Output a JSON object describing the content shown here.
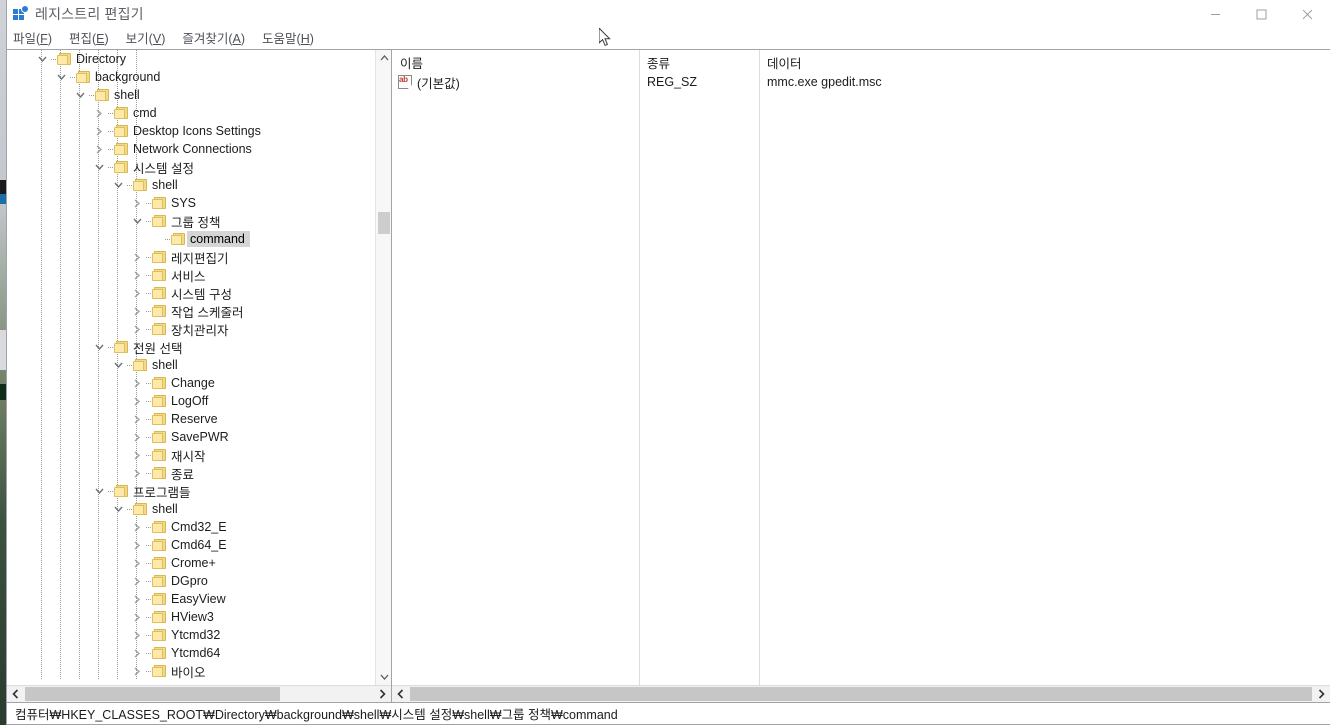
{
  "window": {
    "title": "레지스트리 편집기",
    "app_icon": "registry-grid-icon",
    "controls": {
      "minimize": "minimize-icon",
      "maximize": "maximize-icon",
      "close": "close-icon"
    }
  },
  "menu": [
    {
      "text": "파일",
      "pre": "파일(",
      "accel": "F",
      "post": ")"
    },
    {
      "text": "편집",
      "pre": "편집(",
      "accel": "E",
      "post": ")"
    },
    {
      "text": "보기",
      "pre": "보기(",
      "accel": "V",
      "post": ")"
    },
    {
      "text": "즐겨찾기",
      "pre": "즐겨찾기(",
      "accel": "A",
      "post": ")"
    },
    {
      "text": "도움말",
      "pre": "도움말(",
      "accel": "H",
      "post": ")"
    }
  ],
  "tree": {
    "rows": [
      {
        "label": "Directory",
        "depth": 1,
        "state": "expanded"
      },
      {
        "label": "background",
        "depth": 2,
        "state": "expanded"
      },
      {
        "label": "shell",
        "depth": 3,
        "state": "expanded"
      },
      {
        "label": "cmd",
        "depth": 4,
        "state": "collapsed"
      },
      {
        "label": "Desktop Icons Settings",
        "depth": 4,
        "state": "collapsed"
      },
      {
        "label": "Network Connections",
        "depth": 4,
        "state": "collapsed"
      },
      {
        "label": "시스템 설정",
        "depth": 4,
        "state": "expanded"
      },
      {
        "label": "shell",
        "depth": 5,
        "state": "expanded"
      },
      {
        "label": "SYS",
        "depth": 6,
        "state": "collapsed"
      },
      {
        "label": "그룹 정책",
        "depth": 6,
        "state": "expanded"
      },
      {
        "label": "command",
        "depth": 7,
        "state": "leaf",
        "selected": true
      },
      {
        "label": "레지편집기",
        "depth": 6,
        "state": "collapsed"
      },
      {
        "label": "서비스",
        "depth": 6,
        "state": "collapsed"
      },
      {
        "label": "시스템 구성",
        "depth": 6,
        "state": "collapsed"
      },
      {
        "label": "작업 스케줄러",
        "depth": 6,
        "state": "collapsed"
      },
      {
        "label": "장치관리자",
        "depth": 6,
        "state": "collapsed"
      },
      {
        "label": "전원 선택",
        "depth": 4,
        "state": "expanded"
      },
      {
        "label": "shell",
        "depth": 5,
        "state": "expanded"
      },
      {
        "label": "Change",
        "depth": 6,
        "state": "collapsed"
      },
      {
        "label": "LogOff",
        "depth": 6,
        "state": "collapsed"
      },
      {
        "label": "Reserve",
        "depth": 6,
        "state": "collapsed"
      },
      {
        "label": "SavePWR",
        "depth": 6,
        "state": "collapsed"
      },
      {
        "label": "재시작",
        "depth": 6,
        "state": "collapsed"
      },
      {
        "label": "종료",
        "depth": 6,
        "state": "collapsed"
      },
      {
        "label": "프로그램들",
        "depth": 4,
        "state": "expanded"
      },
      {
        "label": "shell",
        "depth": 5,
        "state": "expanded"
      },
      {
        "label": "Cmd32_E",
        "depth": 6,
        "state": "collapsed"
      },
      {
        "label": "Cmd64_E",
        "depth": 6,
        "state": "collapsed"
      },
      {
        "label": "Crome+",
        "depth": 6,
        "state": "collapsed"
      },
      {
        "label": "DGpro",
        "depth": 6,
        "state": "collapsed"
      },
      {
        "label": "EasyView",
        "depth": 6,
        "state": "collapsed"
      },
      {
        "label": "HView3",
        "depth": 6,
        "state": "collapsed"
      },
      {
        "label": "Ytcmd32",
        "depth": 6,
        "state": "collapsed"
      },
      {
        "label": "Ytcmd64",
        "depth": 6,
        "state": "collapsed"
      },
      {
        "label": "바이오",
        "depth": 6,
        "state": "collapsed"
      }
    ],
    "vscroll": {
      "up": "scroll-up-icon",
      "down": "scroll-down-icon"
    },
    "hscroll": {
      "left": "scroll-left-icon",
      "right": "scroll-right-icon"
    }
  },
  "list": {
    "columns": [
      {
        "label": "이름"
      },
      {
        "label": "종류"
      },
      {
        "label": "데이터"
      }
    ],
    "rows": [
      {
        "icon": "string-value-icon",
        "name": "(기본값)",
        "type": "REG_SZ",
        "data": "mmc.exe gpedit.msc"
      }
    ],
    "hscroll": {
      "left": "scroll-left-icon",
      "right": "scroll-right-icon"
    }
  },
  "status": {
    "path": "컴퓨터₩HKEY_CLASSES_ROOT₩Directory₩background₩shell₩시스템 설정₩shell₩그룹 정책₩command"
  },
  "colors": {
    "folder_fill": "#ffe9a8",
    "folder_edge": "#dcc05c",
    "selection": "#d5d5d5",
    "accent_blue": "#2b7cd3",
    "string_icon_red": "#c0392b"
  }
}
